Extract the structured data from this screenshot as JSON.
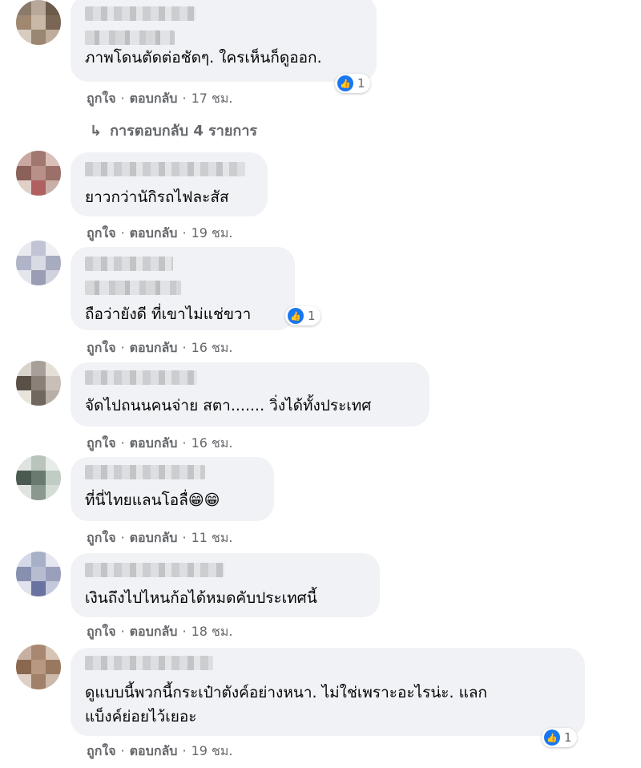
{
  "comments": [
    {
      "text": "ภาพโดนตัดต่อชัดๆ. ใครเห็นก็ดูออก.",
      "like_label": "ถูกใจ",
      "reply_label": "ตอบกลับ",
      "time": "17 ชม.",
      "reaction_count": "1",
      "replies_link": "การตอบกลับ 4 รายการ"
    },
    {
      "text": "ยาวกว่านักิรถไฟละสัส",
      "like_label": "ถูกใจ",
      "reply_label": "ตอบกลับ",
      "time": "19 ชม."
    },
    {
      "text": "ถือว่ายังดี ที่เขาไม่แช่ขวา",
      "like_label": "ถูกใจ",
      "reply_label": "ตอบกลับ",
      "time": "16 ชม.",
      "reaction_count": "1"
    },
    {
      "text": "จัดไปถนนคนจ่าย สตา....... วิ่งได้ทั้งประเทศ",
      "like_label": "ถูกใจ",
      "reply_label": "ตอบกลับ",
      "time": "16 ชม."
    },
    {
      "text": "ที่นี่ไทยแลนโอลื่😁😁",
      "like_label": "ถูกใจ",
      "reply_label": "ตอบกลับ",
      "time": "11 ชม."
    },
    {
      "text": "เงินถึงไปไหนก้อได้หมดคับประเทศนี้",
      "like_label": "ถูกใจ",
      "reply_label": "ตอบกลับ",
      "time": "18 ชม."
    },
    {
      "text_line1": "ดูแบบนี้พวกนี้กระเป๋าตังค์อย่างหนา. ไม่ใช่เพราะอะไรน่ะ. แลก",
      "text_line2": "แบ็งค์ย่อยไว้เยอะ",
      "like_label": "ถูกใจ",
      "reply_label": "ตอบกลับ",
      "time": "19 ชม.",
      "reaction_count": "1"
    }
  ],
  "icons": {
    "like": "thumbs-up-icon",
    "reply_arrow": "reply-arrow-icon"
  },
  "colors": {
    "bubble": "#f0f2f5",
    "meta": "#65676b",
    "like_blue": "#1877f2"
  }
}
